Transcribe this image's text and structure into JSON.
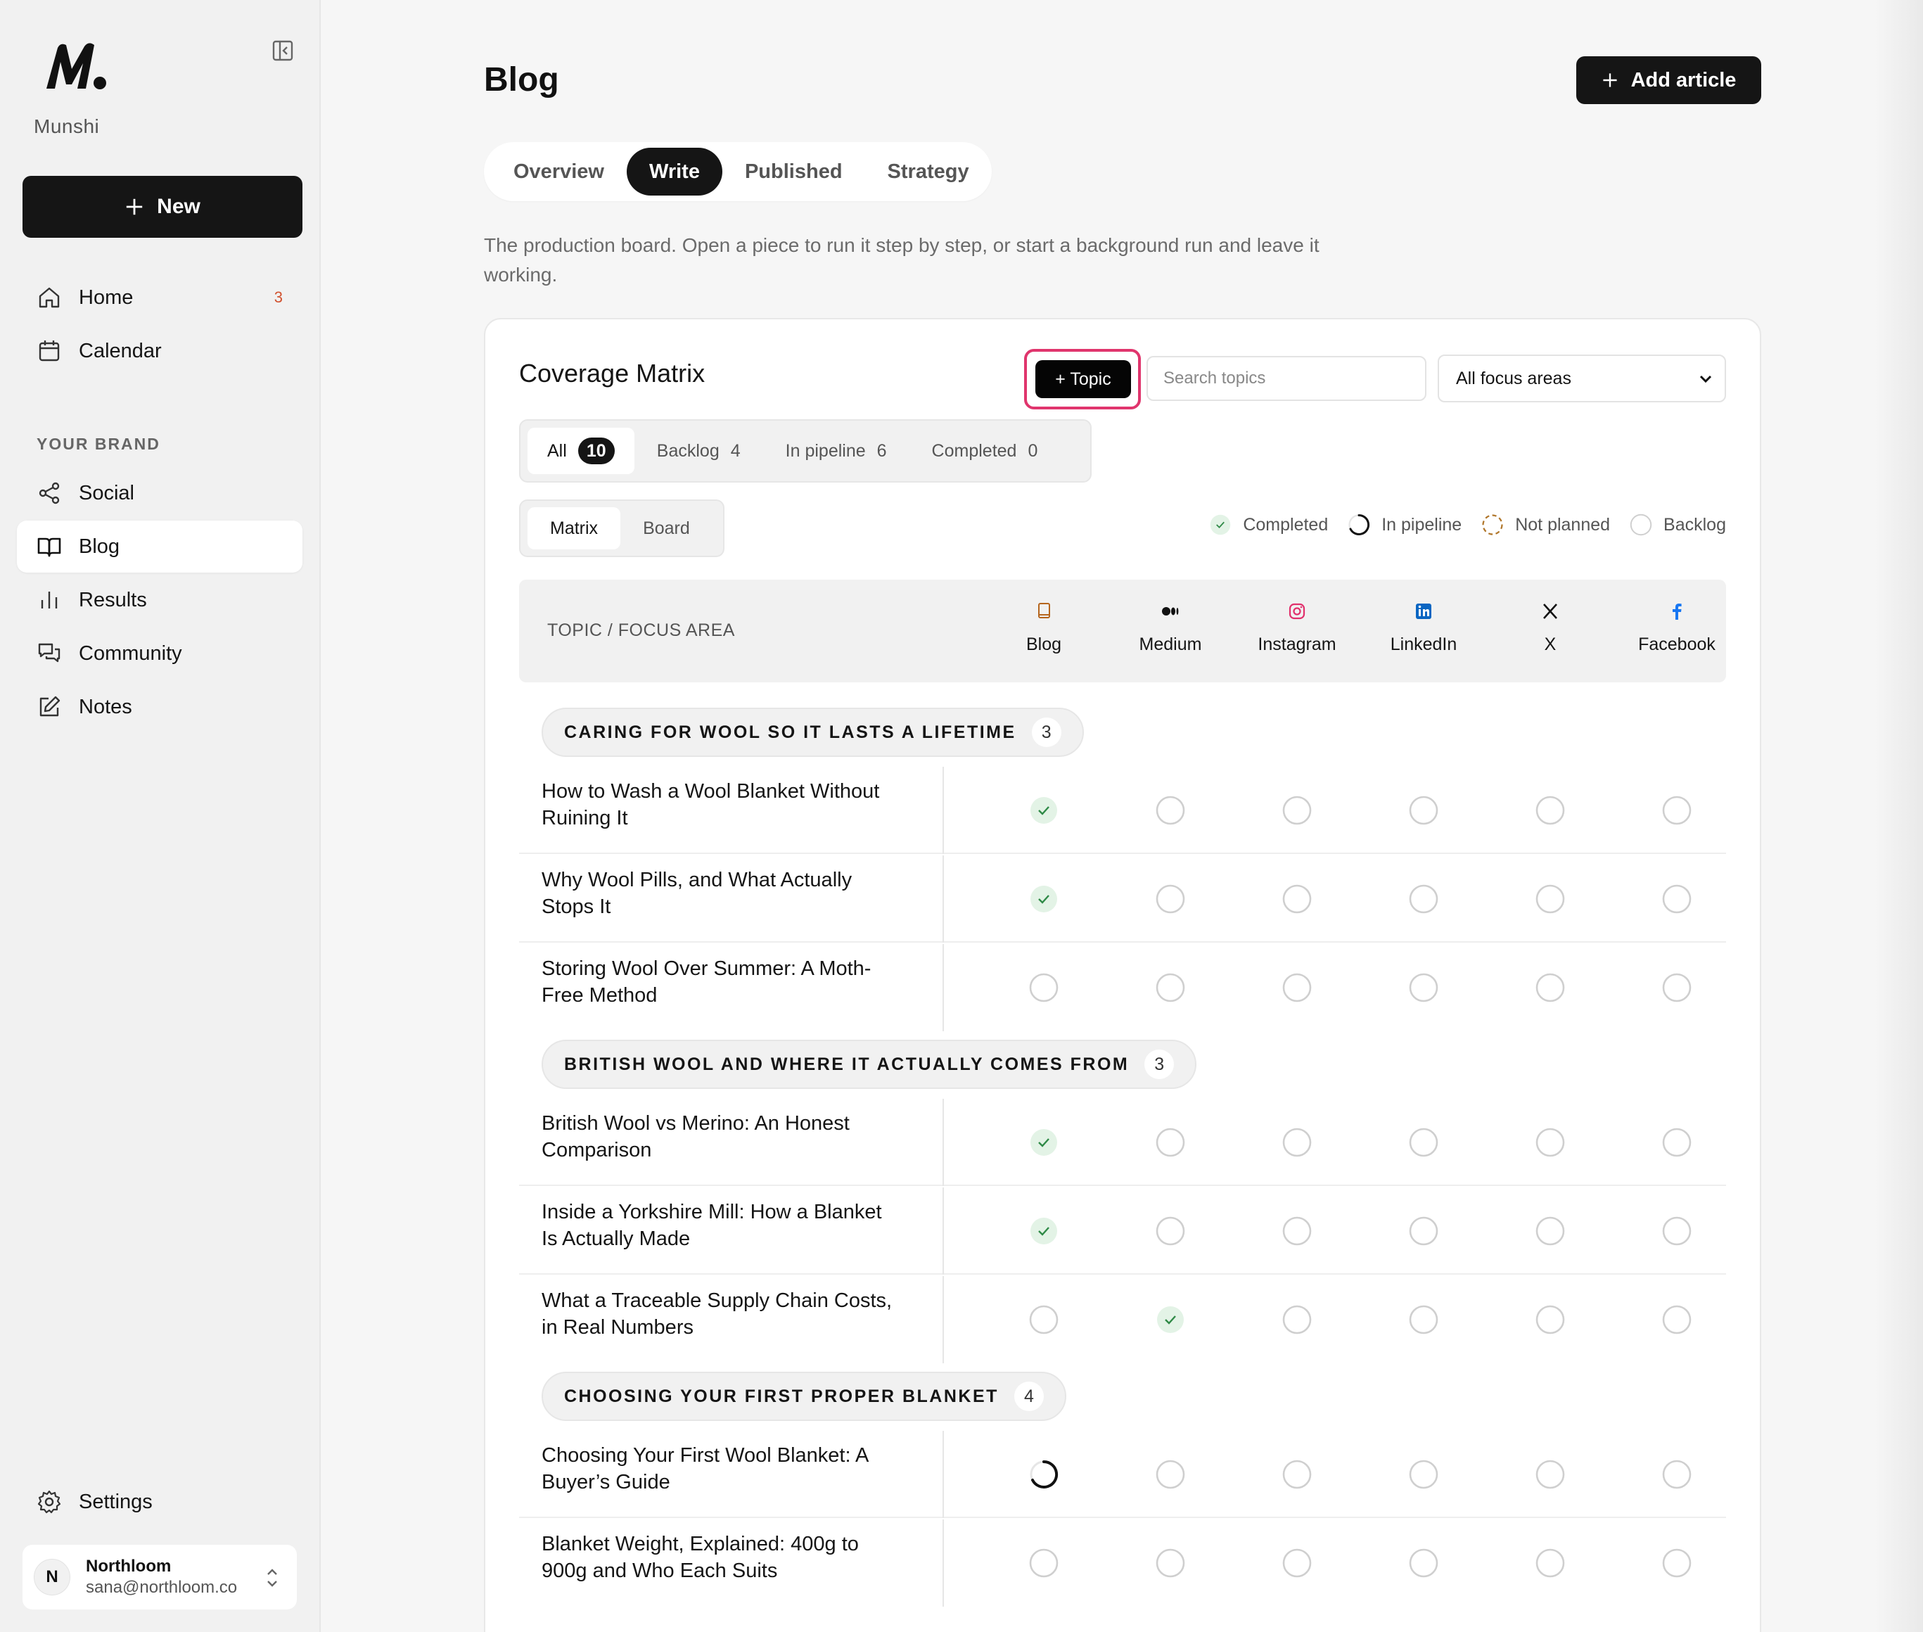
{
  "sidebar": {
    "brand": "Munshi",
    "new_label": "New",
    "nav": [
      {
        "label": "Home",
        "icon": "home-icon",
        "badge": "3"
      },
      {
        "label": "Calendar",
        "icon": "calendar-icon"
      }
    ],
    "section_label": "YOUR BRAND",
    "brand_nav": [
      {
        "label": "Social",
        "icon": "share-icon"
      },
      {
        "label": "Blog",
        "icon": "book-icon",
        "active": true
      },
      {
        "label": "Results",
        "icon": "bar-chart-icon"
      },
      {
        "label": "Community",
        "icon": "chat-icon"
      },
      {
        "label": "Notes",
        "icon": "edit-icon"
      }
    ],
    "settings_label": "Settings",
    "account": {
      "initial": "N",
      "name": "Northloom",
      "email": "sana@northloom.co"
    }
  },
  "header": {
    "title": "Blog",
    "add_article": "Add article",
    "tabs": [
      "Overview",
      "Write",
      "Published",
      "Strategy"
    ],
    "active_tab": "Write",
    "description": "The production board. Open a piece to run it step by step, or start a background run and leave it working."
  },
  "matrix": {
    "title": "Coverage Matrix",
    "topic_button": "+ Topic",
    "search_placeholder": "Search topics",
    "focus_select": "All focus areas",
    "filters": [
      {
        "label": "All",
        "count": "10"
      },
      {
        "label": "Backlog",
        "count": "4"
      },
      {
        "label": "In pipeline",
        "count": "6"
      },
      {
        "label": "Completed",
        "count": "0"
      }
    ],
    "views": [
      "Matrix",
      "Board"
    ],
    "legend": [
      {
        "label": "Completed",
        "status": "completed"
      },
      {
        "label": "In pipeline",
        "status": "pipeline"
      },
      {
        "label": "Not planned",
        "status": "notplanned"
      },
      {
        "label": "Backlog",
        "status": "backlog"
      }
    ],
    "column_header_label": "TOPIC / FOCUS AREA",
    "channels": [
      {
        "label": "Blog",
        "icon": "blog-book-icon",
        "color": "#b5651d"
      },
      {
        "label": "Medium",
        "icon": "medium-icon",
        "color": "#111111"
      },
      {
        "label": "Instagram",
        "icon": "instagram-icon",
        "color": "#e1306c"
      },
      {
        "label": "LinkedIn",
        "icon": "linkedin-icon",
        "color": "#0a66c2"
      },
      {
        "label": "X",
        "icon": "x-icon",
        "color": "#111111"
      },
      {
        "label": "Facebook",
        "icon": "facebook-icon",
        "color": "#1877f2"
      }
    ],
    "groups": [
      {
        "name": "CARING FOR WOOL SO IT LASTS A LIFETIME",
        "count": "3",
        "rows": [
          {
            "title": "How to Wash a Wool Blanket Without Ruining It",
            "cells": [
              "completed",
              "backlog",
              "backlog",
              "backlog",
              "backlog",
              "backlog"
            ]
          },
          {
            "title": "Why Wool Pills, and What Actually Stops It",
            "cells": [
              "completed",
              "backlog",
              "backlog",
              "backlog",
              "backlog",
              "backlog"
            ]
          },
          {
            "title": "Storing Wool Over Summer: A Moth-Free Method",
            "cells": [
              "backlog",
              "backlog",
              "backlog",
              "backlog",
              "backlog",
              "backlog"
            ]
          }
        ]
      },
      {
        "name": "BRITISH WOOL AND WHERE IT ACTUALLY COMES FROM",
        "count": "3",
        "rows": [
          {
            "title": "British Wool vs Merino: An Honest Comparison",
            "cells": [
              "completed",
              "backlog",
              "backlog",
              "backlog",
              "backlog",
              "backlog"
            ]
          },
          {
            "title": "Inside a Yorkshire Mill: How a Blanket Is Actually Made",
            "cells": [
              "completed",
              "backlog",
              "backlog",
              "backlog",
              "backlog",
              "backlog"
            ]
          },
          {
            "title": "What a Traceable Supply Chain Costs, in Real Numbers",
            "cells": [
              "backlog",
              "completed",
              "backlog",
              "backlog",
              "backlog",
              "backlog"
            ]
          }
        ]
      },
      {
        "name": "CHOOSING YOUR FIRST PROPER BLANKET",
        "count": "4",
        "rows": [
          {
            "title": "Choosing Your First Wool Blanket: A Buyer’s Guide",
            "cells": [
              "pipeline",
              "backlog",
              "backlog",
              "backlog",
              "backlog",
              "backlog"
            ]
          },
          {
            "title": "Blanket Weight, Explained: 400g to 900g and Who Each Suits",
            "cells": [
              "backlog",
              "backlog",
              "backlog",
              "backlog",
              "backlog",
              "backlog"
            ]
          }
        ]
      }
    ]
  }
}
